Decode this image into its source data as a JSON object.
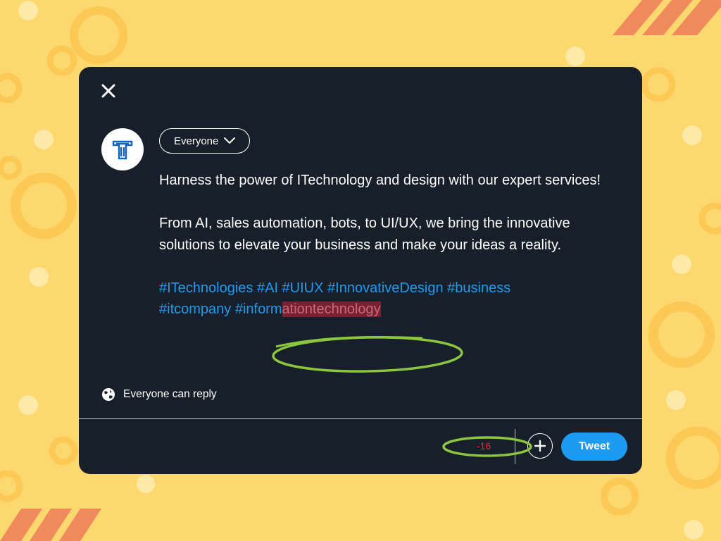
{
  "composer": {
    "audience_label": "Everyone",
    "body_paragraphs": [
      "Harness the power of ITechnology and design with our expert services!",
      "From AI, sales automation, bots, to UI/UX, we bring the innovative solutions to elevate your business and make your ideas a reality."
    ],
    "hashtags_line_1": "#ITechnologies #AI #UIUX #InnovativeDesign #business",
    "hashtags_line_2_within_limit": "#itcompany #inform",
    "hashtags_line_2_over_limit": "ationtechnology",
    "reply_setting": "Everyone can reply",
    "characters_remaining": "-16",
    "tweet_label": "Tweet"
  },
  "icons": {
    "close": "close-icon",
    "audience_chevron": "chevron-down-icon",
    "reply_globe": "globe-icon",
    "add": "plus-icon",
    "avatar_logo": "t-logo-icon"
  },
  "colors": {
    "background": "#fdd86e",
    "card": "#17202a",
    "accent": "#1d9bf0",
    "over_limit_highlight": "#7a2030",
    "counter_negative": "#f4212e",
    "annotation_marker": "#8cc63f"
  }
}
